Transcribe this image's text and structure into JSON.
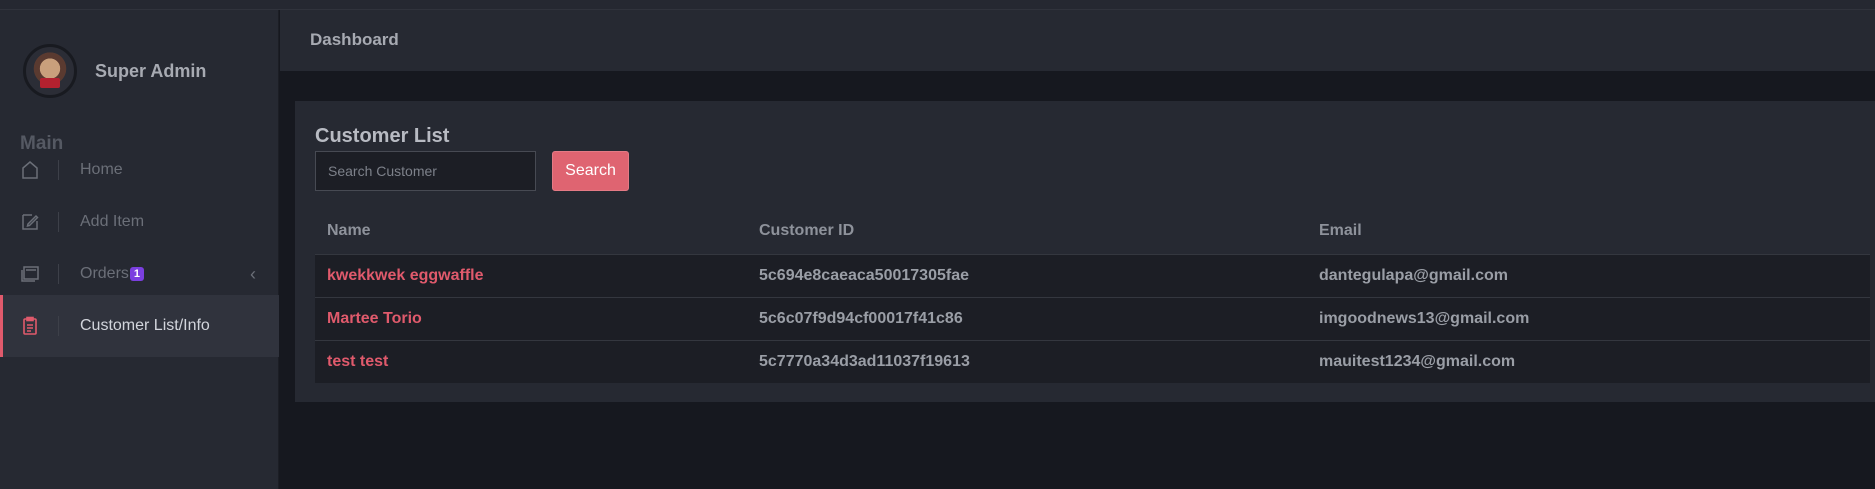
{
  "sidebar": {
    "profile_name": "Super Admin",
    "section_label": "Main",
    "items": [
      {
        "label": "Home",
        "icon": "home-icon"
      },
      {
        "label": "Add Item",
        "icon": "edit-icon"
      },
      {
        "label": "Orders",
        "icon": "orders-icon",
        "badge": "1"
      },
      {
        "label": "Customer List/Info",
        "icon": "clipboard-icon",
        "active": true
      }
    ]
  },
  "header": {
    "title": "Dashboard"
  },
  "main": {
    "card_title": "Customer List",
    "search": {
      "placeholder": "Search Customer",
      "value": "",
      "button_label": "Search"
    },
    "table": {
      "columns": [
        "Name",
        "Customer ID",
        "Email"
      ],
      "rows": [
        {
          "name": "kwekkwek eggwaffle",
          "id": "5c694e8caeaca50017305fae",
          "email": "dantegulapa@gmail.com"
        },
        {
          "name": "Martee Torio",
          "id": "5c6c07f9d94cf00017f41c86",
          "email": "imgoodnews13@gmail.com"
        },
        {
          "name": "test test",
          "id": "5c7770a34d3ad11037f19613",
          "email": "mauitest1234@gmail.com"
        }
      ]
    }
  },
  "colors": {
    "accent": "#df6471",
    "badge": "#7b3fe0",
    "sidebar_bg": "#262932",
    "page_bg": "#16181f"
  }
}
